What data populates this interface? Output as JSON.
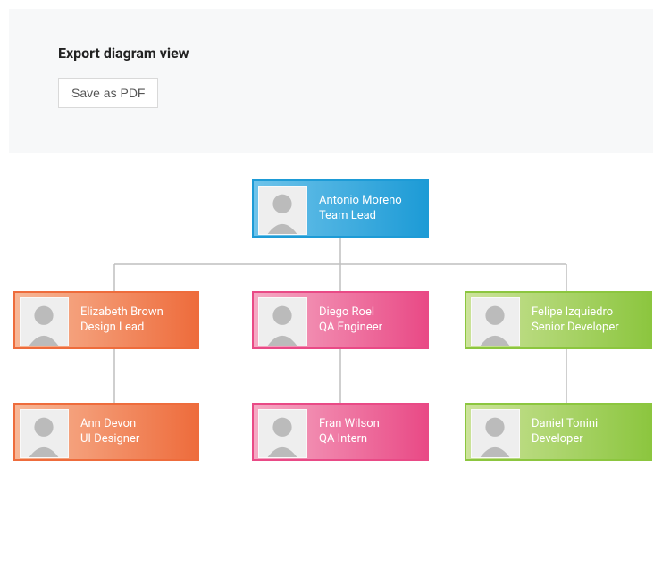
{
  "panel": {
    "title": "Export diagram view",
    "save_label": "Save as PDF"
  },
  "colors": {
    "blue": "#1d9bd6",
    "orange": "#ee6c3c",
    "pink": "#e94a86",
    "green": "#8cc63f",
    "connector": "#bfbfbf"
  },
  "nodes": {
    "root": {
      "name": "Antonio Moreno",
      "title": "Team Lead",
      "color": "blue"
    },
    "left": {
      "name": "Elizabeth Brown",
      "title": "Design Lead",
      "color": "orange"
    },
    "mid": {
      "name": "Diego Roel",
      "title": "QA Engineer",
      "color": "pink"
    },
    "right": {
      "name": "Felipe Izquiedro",
      "title": "Senior Developer",
      "color": "green"
    },
    "left2": {
      "name": "Ann Devon",
      "title": "UI Designer",
      "color": "orange"
    },
    "mid2": {
      "name": "Fran Wilson",
      "title": "QA Intern",
      "color": "pink"
    },
    "right2": {
      "name": "Daniel Tonini",
      "title": "Developer",
      "color": "green"
    }
  }
}
